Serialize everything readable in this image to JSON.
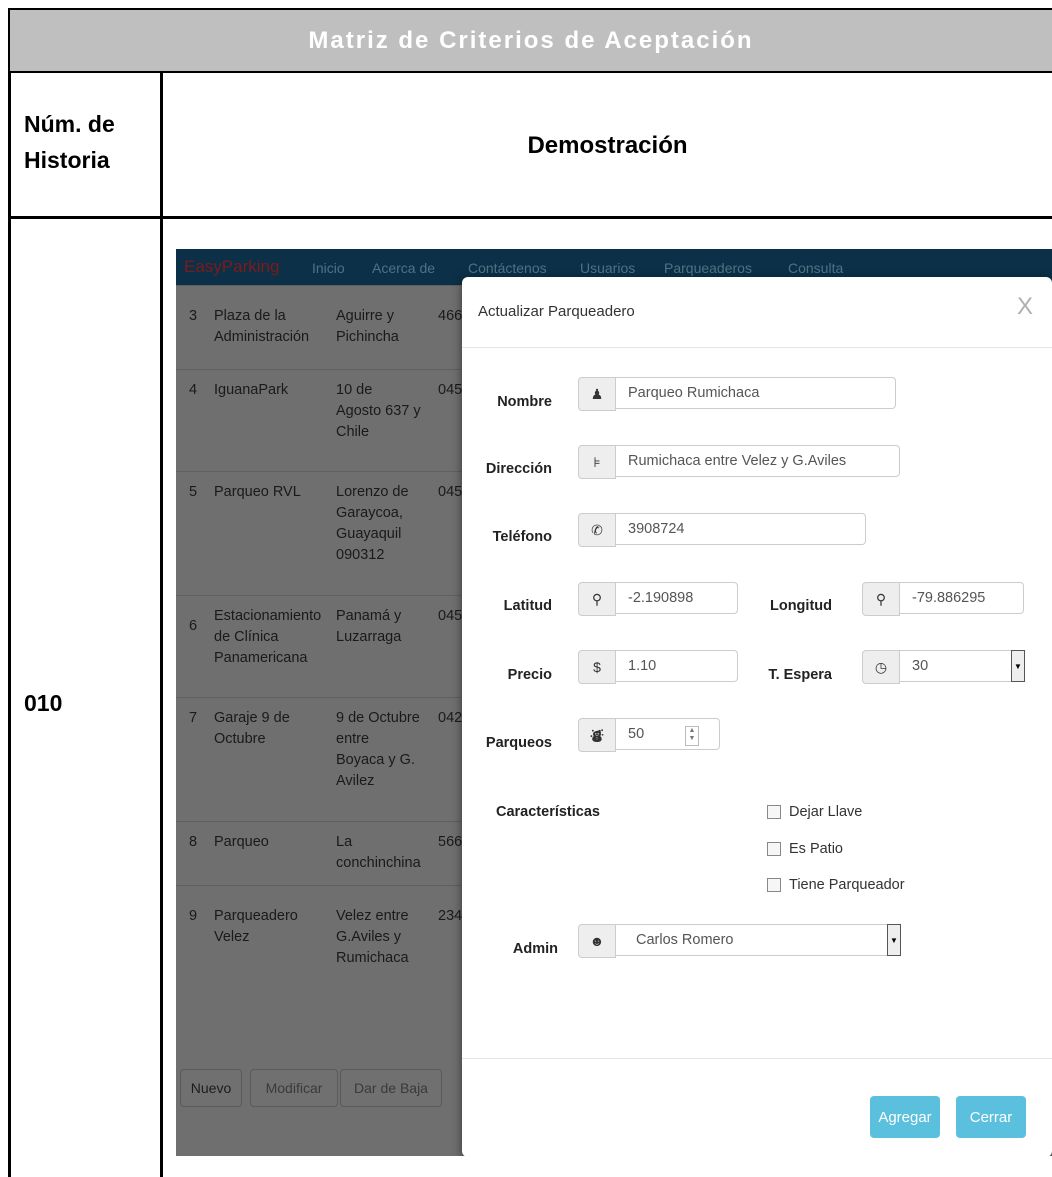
{
  "document": {
    "title": "Matriz de Criterios de Aceptación",
    "col_historia": "Núm. de Historia",
    "col_historia_line1": "Núm. de",
    "col_historia_line2": "Historia",
    "col_demostracion": "Demostración",
    "historia_num": "010"
  },
  "navbar": {
    "brand": "EasyParking",
    "items": [
      "Inicio",
      "Acerca de",
      "Contáctenos",
      "Usuarios",
      "Parqueaderos",
      "Consulta"
    ]
  },
  "table_rows": [
    {
      "id": "3",
      "name": [
        "Plaza de la",
        "Administración"
      ],
      "address": [
        "Aguirre y",
        "Pichincha"
      ],
      "phone": "466"
    },
    {
      "id": "4",
      "name": [
        "IguanaPark"
      ],
      "address": [
        "10 de",
        "Agosto 637 y",
        "Chile"
      ],
      "phone": "045"
    },
    {
      "id": "5",
      "name": [
        "Parqueo RVL"
      ],
      "address": [
        "Lorenzo de",
        "Garaycoa,",
        "Guayaquil",
        "090312"
      ],
      "phone": "045"
    },
    {
      "id": "6",
      "name": [
        "Estacionamiento",
        "de Clínica",
        "Panamericana"
      ],
      "address": [
        "Panamá y",
        "Luzarraga"
      ],
      "phone": "045"
    },
    {
      "id": "7",
      "name": [
        "Garaje 9 de",
        "Octubre"
      ],
      "address": [
        "9 de Octubre",
        "entre",
        "Boyaca y G.",
        "Avilez"
      ],
      "phone": "042"
    },
    {
      "id": "8",
      "name": [
        "Parqueo"
      ],
      "address": [
        "La",
        "conchinchina"
      ],
      "phone": "566"
    },
    {
      "id": "9",
      "name": [
        "Parqueadero",
        "Velez"
      ],
      "address": [
        "Velez entre",
        "G.Aviles y",
        "Rumichaca"
      ],
      "phone": "234"
    }
  ],
  "bg_buttons": {
    "nuevo": "Nuevo",
    "modificar": "Modificar",
    "baja": "Dar de Baja"
  },
  "modal": {
    "title": "Actualizar Parqueadero",
    "close": "X",
    "nombre_label": "Nombre",
    "nombre_value": "Parqueo Rumichaca",
    "direccion_label": "Dirección",
    "direccion_value": "Rumichaca entre Velez y G.Aviles",
    "telefono_label": "Teléfono",
    "telefono_value": "3908724",
    "latitud_label": "Latitud",
    "latitud_value": "-2.190898",
    "longitud_label": "Longitud",
    "longitud_value": "-79.886295",
    "precio_label": "Precio",
    "precio_value": "1.10",
    "espera_label": "T. Espera",
    "espera_value": "30",
    "parqueos_label": "Parqueos",
    "parqueos_value": "50",
    "caracteristicas_label": "Características",
    "checks": [
      "Dejar Llave",
      "Es Patio",
      "Tiene Parqueador"
    ],
    "admin_label": "Admin",
    "admin_value": "Carlos Romero",
    "agregar": "Agregar",
    "cerrar": "Cerrar"
  }
}
